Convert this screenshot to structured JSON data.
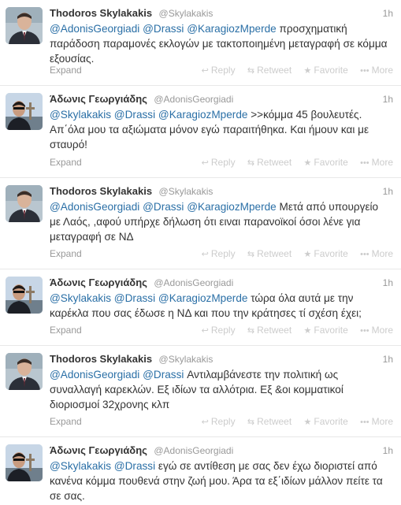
{
  "tweets": [
    {
      "fullname": "Thodoros Skylakakis",
      "username": "@Skylakakis",
      "time": "1h",
      "mentions": [
        "@AdonisGeorgiadi",
        "@Drassi",
        "@KaragiozMperde"
      ],
      "text": "προσχηματική παράδοση παραμονές εκλογών με τακτοποιημένη μεταγραφή σε κόμμα εξουσίας.",
      "avatar": "skylakakis"
    },
    {
      "fullname": "Άδωνις Γεωργιάδης",
      "username": "@AdonisGeorgiadi",
      "time": "1h",
      "mentions": [
        "@Skylakakis",
        "@Drassi",
        "@KaragiozMperde"
      ],
      "text": ">>κόμμα 45 βουλευτές. Απ΄όλα μου τα αξιώματα μόνον εγώ παραιτήθηκα. Και ήμουν και με σταυρό!",
      "avatar": "georgiadis"
    },
    {
      "fullname": "Thodoros Skylakakis",
      "username": "@Skylakakis",
      "time": "1h",
      "mentions": [
        "@AdonisGeorgiadi",
        "@Drassi",
        "@KaragiozMperde"
      ],
      "text": "Μετά από υπουργείο με Λαός, ,αφού υπήρχε δήλωση ότι ειναι παρανοϊκοί όσοι λένε για μεταγραφή σε ΝΔ",
      "avatar": "skylakakis"
    },
    {
      "fullname": "Άδωνις Γεωργιάδης",
      "username": "@AdonisGeorgiadi",
      "time": "1h",
      "mentions": [
        "@Skylakakis",
        "@Drassi",
        "@KaragiozMperde"
      ],
      "text": "τώρα όλα αυτά με την καρέκλα που σας έδωσε η ΝΔ και που την κράτησες τί σχέση έχει;",
      "avatar": "georgiadis"
    },
    {
      "fullname": "Thodoros Skylakakis",
      "username": "@Skylakakis",
      "time": "1h",
      "mentions": [
        "@AdonisGeorgiadi",
        "@Drassi"
      ],
      "text": "Αντιλαμβάνεστε την πολιτική ως συναλλαγή καρεκλών. Εξ ιδίων τα αλλότρια. Εξ &οι κομματικοί διοριοσμοί 32χρονης κλπ",
      "avatar": "skylakakis"
    },
    {
      "fullname": "Άδωνις Γεωργιάδης",
      "username": "@AdonisGeorgiadi",
      "time": "1h",
      "mentions": [
        "@Skylakakis",
        "@Drassi"
      ],
      "text": "εγώ σε αντίθεση με σας δεν έχω διοριστεί από κανένα κόμμα πουθενά στην ζωή μου. Άρα τα εξ΄ιδίων μάλλον πείτε τα σε σας.",
      "avatar": "georgiadis"
    }
  ],
  "labels": {
    "expand": "Expand",
    "reply": "Reply",
    "retweet": "Retweet",
    "favorite": "Favorite",
    "more": "More"
  },
  "colors": {
    "mention": "#2a6fa6",
    "muted": "#999999",
    "action": "#cccccc"
  }
}
